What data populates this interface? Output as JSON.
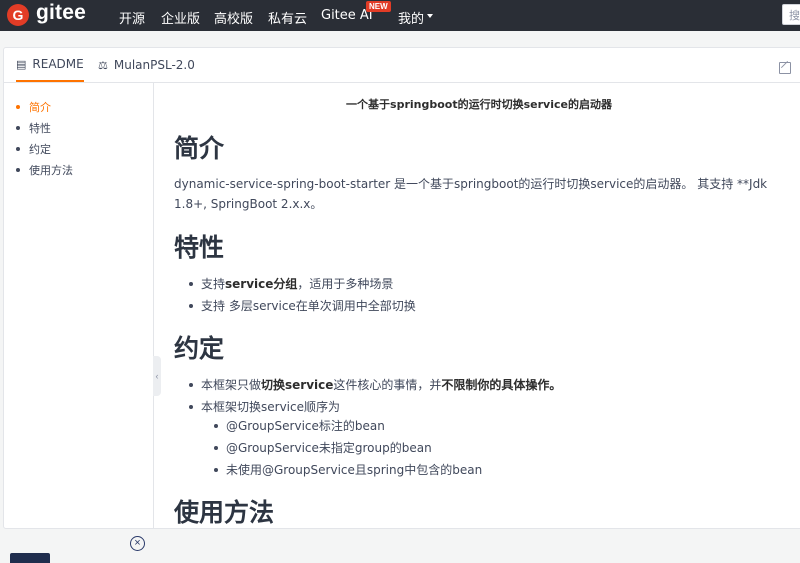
{
  "header": {
    "logo_letter": "G",
    "brand": "gitee",
    "nav": [
      "开源",
      "企业版",
      "高校版",
      "私有云",
      "Gitee AI",
      "我的"
    ],
    "new_badge": "NEW",
    "search_placeholder": "搜"
  },
  "tabs": [
    {
      "label": "README",
      "icon": "document-icon",
      "active": true
    },
    {
      "label": "MulanPSL-2.0",
      "icon": "scale-icon",
      "active": false
    }
  ],
  "toc": {
    "items": [
      "简介",
      "特性",
      "约定",
      "使用方法"
    ],
    "active": "简介"
  },
  "content": {
    "title": "一个基于springboot的运行时切换service的启动器",
    "sections": [
      {
        "heading": "简介",
        "paragraph": "dynamic-service-spring-boot-starter 是一个基于springboot的运行时切换service的启动器。 其支持 **Jdk 1.8+, SpringBoot 2.x.x。"
      },
      {
        "heading": "特性",
        "items": [
          {
            "prefix": "支持 ",
            "bold": "service分组",
            "suffix": "，适用于多种场景"
          },
          {
            "prefix": "支持 多层service在单次调用中全部切换",
            "bold": "",
            "suffix": ""
          }
        ]
      },
      {
        "heading": "约定",
        "items": [
          {
            "prefix": "本框架只做 ",
            "bold": "切换service",
            "suffix": " 这件核心的事情，并",
            "bold2": "不限制你的具体操作。"
          },
          {
            "prefix": "本框架切换service顺序为",
            "bold": "",
            "suffix": ""
          }
        ],
        "subitems": [
          "@GroupService标注的bean",
          "@GroupService未指定group的bean",
          "未使用@GroupService且spring中包含的bean"
        ]
      },
      {
        "heading": "使用方法"
      }
    ]
  },
  "colors": {
    "topbar": "#2a2e36",
    "brand_red": "#e23c26",
    "accent_orange": "#fe7300"
  }
}
